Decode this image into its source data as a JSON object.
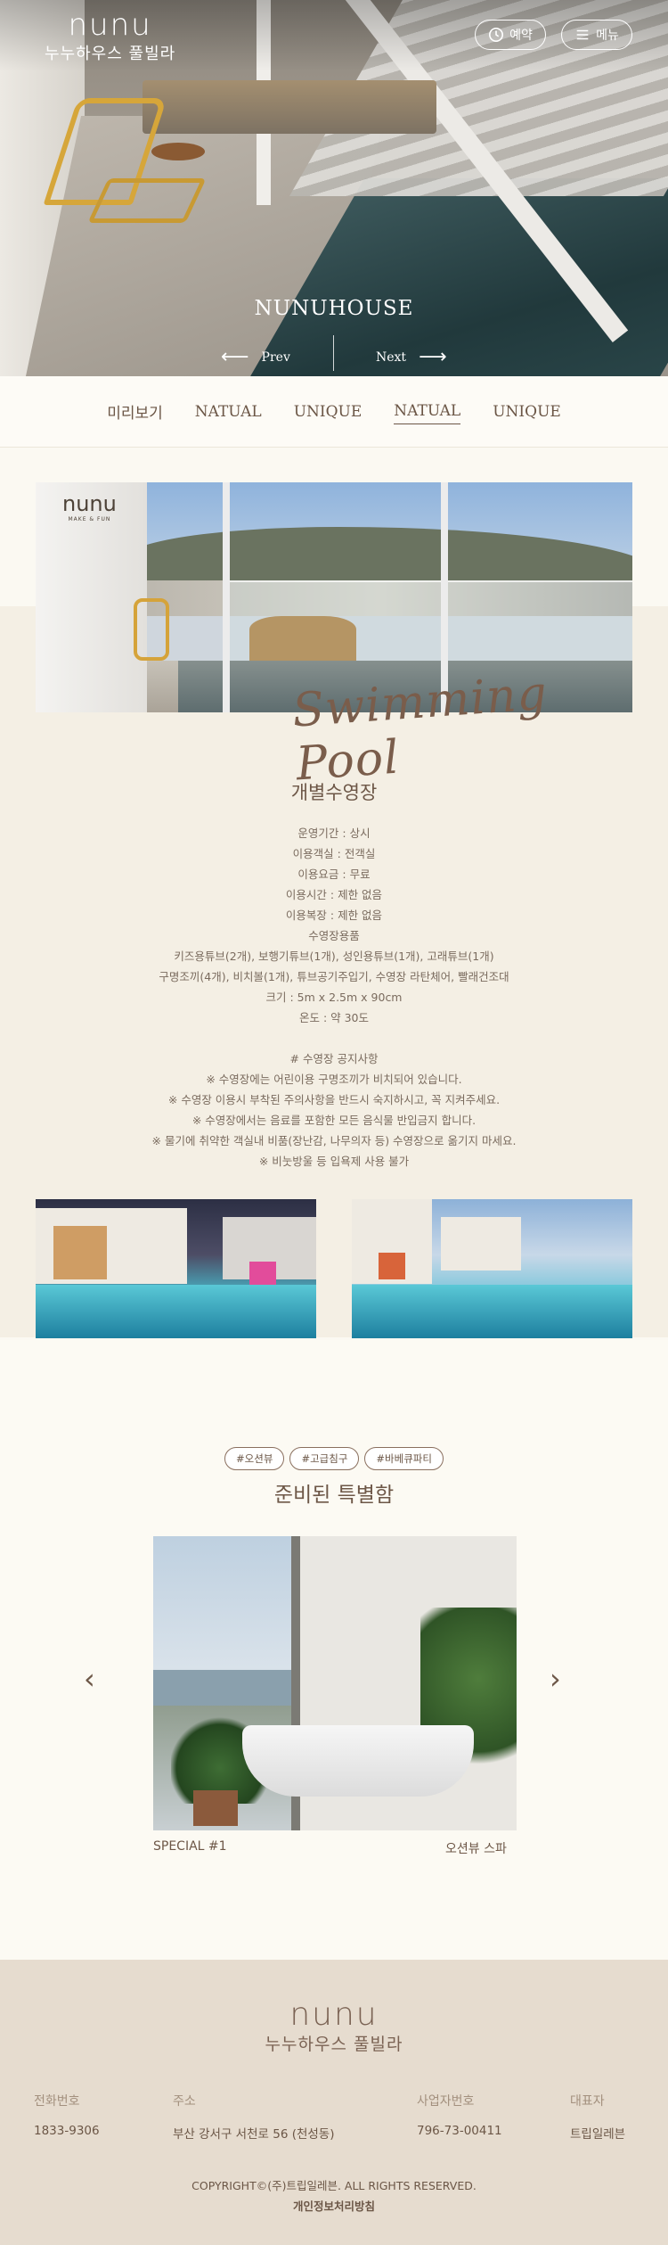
{
  "brand": {
    "logo_mark": "nunu",
    "logo_sub": "MAKE & FUN",
    "name_ko": "누누하우스 풀빌라"
  },
  "header": {
    "reserve_label": "예약",
    "menu_label": "메뉴"
  },
  "hero": {
    "title": "NUNUHOUSE",
    "prev_label": "Prev",
    "next_label": "Next"
  },
  "tabs": [
    {
      "label": "미리보기"
    },
    {
      "label": "NATUAL"
    },
    {
      "label": "UNIQUE"
    },
    {
      "label": "NATUAL",
      "active": true
    },
    {
      "label": "UNIQUE"
    }
  ],
  "pool": {
    "script_title": "Swimming Pool",
    "heading": "개별수영장",
    "info": [
      "운영기간 : 상시",
      "이용객실 : 전객실",
      "이용요금 : 무료",
      "이용시간 : 제한 없음",
      "이용복장 : 제한 없음",
      "수영장용품",
      "키즈용튜브(2개), 보행기튜브(1개), 성인용튜브(1개), 고래튜브(1개)",
      "구명조끼(4개), 비치볼(1개), 튜브공기주입기, 수영장 라탄체어, 빨래건조대",
      "크기 : 5m x 2.5m x 90cm",
      "온도 : 약 30도"
    ],
    "notice": [
      "# 수영장 공지사항",
      "※ 수영장에는 어린이용 구명조끼가 비치되어 있습니다.",
      "※ 수영장 이용시 부착된 주의사항을 반드시 숙지하시고, 꼭 지켜주세요.",
      "※ 수영장에서는 음료를 포함한 모든 음식물 반입금지 합니다.",
      "※ 물기에 취약한 객실내 비품(장난감, 나무의자 등) 수영장으로 옮기지 마세요.",
      "※ 비눗방울 등 입욕제 사용 불가"
    ]
  },
  "special": {
    "tags": [
      "#오션뷰",
      "#고급침구",
      "#바베큐파티"
    ],
    "title": "준비된 특별함",
    "slide_label": "SPECIAL #1",
    "slide_name": "오션뷰 스파",
    "prev_arrow": "‹",
    "next_arrow": "›"
  },
  "footer": {
    "phone_label": "전화번호",
    "phone": "1833-9306",
    "address_label": "주소",
    "address": "부산 강서구 서천로 56 (천성동)",
    "biz_label": "사업자번호",
    "biz": "796-73-00411",
    "ceo_label": "대표자",
    "ceo": "트립일레븐",
    "copyright": "COPYRIGHT©(주)트립일레븐. ALL RIGHTS RESERVED.",
    "privacy": "개인정보처리방침"
  },
  "colors": {
    "accent": "#6b5646",
    "footer_bg": "#e6dccf",
    "band_bg": "#f4efe4"
  }
}
